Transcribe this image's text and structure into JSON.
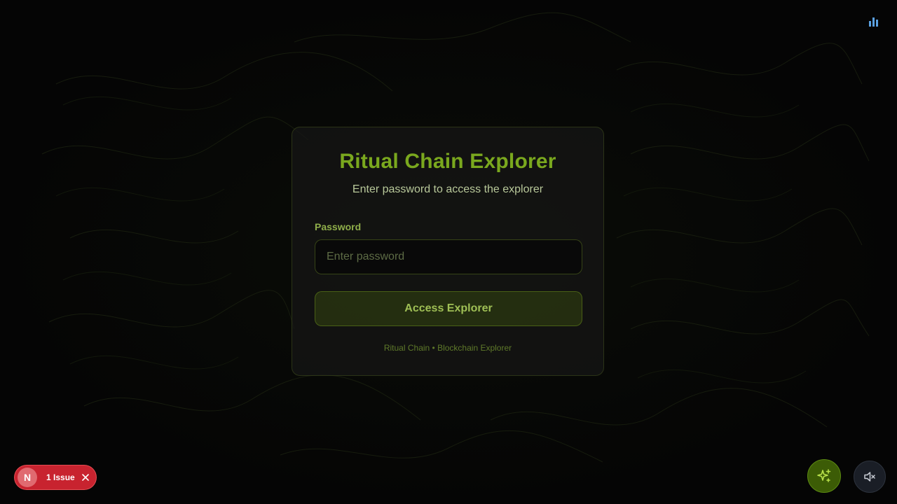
{
  "login_card": {
    "title": "Ritual Chain Explorer",
    "subtitle": "Enter password to access the explorer",
    "password_label": "Password",
    "password_value": "",
    "password_placeholder": "Enter password",
    "submit_label": "Access Explorer",
    "footer": "Ritual Chain • Blockchain Explorer"
  },
  "dev_overlay": {
    "logo_letter": "N",
    "issues_label": "1 Issue",
    "close_icon": "close-icon"
  },
  "floating_controls": {
    "ai_icon": "sparkles-icon",
    "mute_icon": "speaker-muted-icon"
  },
  "top_right_icon": "bar-chart-icon",
  "colors": {
    "accent": "#7aa81e",
    "background": "#050505",
    "card_border": "#3c4a1c",
    "issue_badge": "#c8232f",
    "ai_button": "#3c5c06"
  }
}
